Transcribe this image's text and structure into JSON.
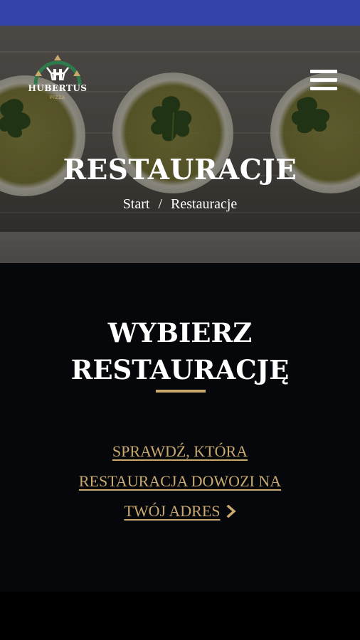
{
  "logo": {
    "name": "HUBERTUS",
    "tagline": "PIZZA"
  },
  "hero": {
    "title": "RESTAURACJE",
    "breadcrumb": {
      "home": "Start",
      "separator": "/",
      "current": "Restauracje"
    }
  },
  "main": {
    "title_line1": "WYBIERZ",
    "title_line2": "RESTAURACJĘ",
    "cta_line1": "SPRAWDŹ, KTÓRA",
    "cta_line2": "RESTAURACJA DOWOZI NA",
    "cta_line3": "TWÓJ ADRES"
  },
  "colors": {
    "status_bar": "#3345a8",
    "accent": "#c9a96e",
    "section_bg": "#05070a"
  },
  "icons": {
    "menu": "hamburger-menu-icon",
    "cta_arrow": "chevron-right-icon"
  }
}
